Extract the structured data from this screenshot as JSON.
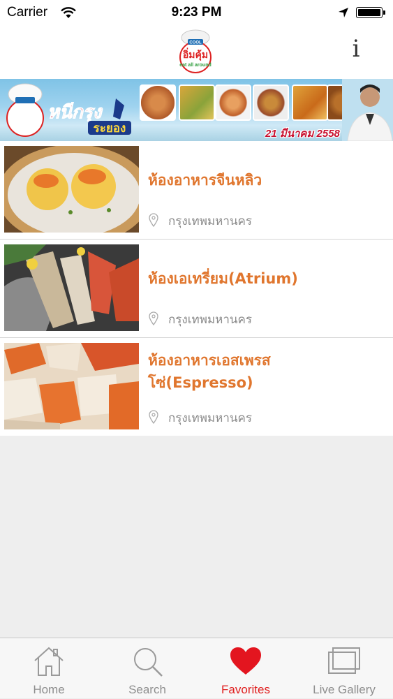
{
  "status_bar": {
    "carrier": "Carrier",
    "time": "9:23 PM"
  },
  "nav": {
    "info_label": "i"
  },
  "banner": {
    "date": "21 มีนาคม 2558",
    "logo_brand": "COOL",
    "logo_name": "อิ่มคุ้ม",
    "logo_tagline": "eat all around",
    "title_line1": "หนีกรุง",
    "title_line2": "ระยอง"
  },
  "restaurants": [
    {
      "name": "ห้องอาหารจีนหลิว",
      "location": "กรุงเทพมหานคร",
      "thumbnail": "dim-sum"
    },
    {
      "name": "ห้องเอเทรี่ยม(Atrium)",
      "location": "กรุงเทพมหานคร",
      "thumbnail": "seafood-platter"
    },
    {
      "name_line1": "ห้องอาหารเอสเพรส",
      "name_line2": "โซ่(Espresso)",
      "location": "กรุงเทพมหานคร",
      "thumbnail": "crab-legs"
    }
  ],
  "tabs": [
    {
      "label": "Home",
      "icon": "home-icon",
      "active": false
    },
    {
      "label": "Search",
      "icon": "search-icon",
      "active": false
    },
    {
      "label": "Favorites",
      "icon": "heart-icon",
      "active": true
    },
    {
      "label": "Live Gallery",
      "icon": "gallery-icon",
      "active": false
    }
  ],
  "colors": {
    "accent": "#e0762e",
    "active_tab": "#e02020",
    "inactive_tab": "#8e8e8e",
    "location_text": "#8a8a8a"
  }
}
